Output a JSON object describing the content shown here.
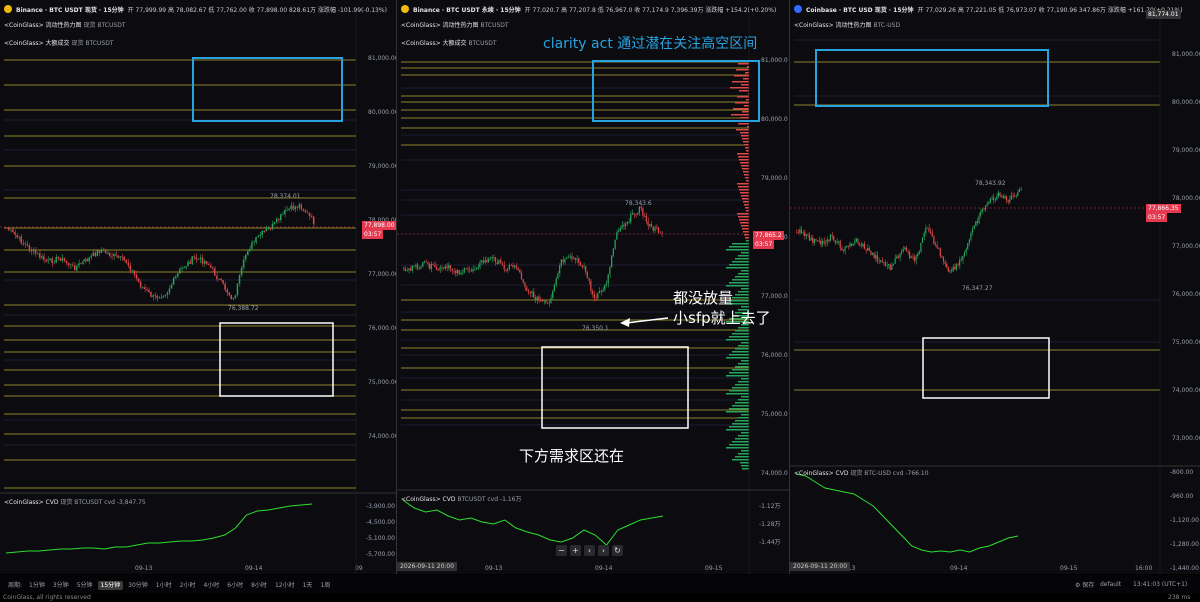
{
  "panel1": {
    "exchange_icon": "binance-icon",
    "title": "Binance · BTC USDT 现货 · 15分钟",
    "ohlc": "开 77,999.99  高 78,082.67  低 77,762.00  收 77,898.00  828.61万  涨跌幅 -101.99(-0.13%)",
    "heatmap_label": "<CoinGlass> 流动性热力图",
    "heatmap_sub": "现货 BTCUSDT",
    "bigtrade_label": "<CoinGlass> 大额成交",
    "bigtrade_sub": "现货 BTCUSDT",
    "cvd_label": "<CoinGlass> CVD",
    "cvd_sub": "现货 BTCUSDT  cvd -3,847.75",
    "high_label": "78,374.01",
    "low_label": "76,388.72",
    "price_axis": [
      "81,000.00",
      "80,000.00",
      "79,000.00",
      "78,000.00",
      "77,000.00",
      "76,000.00",
      "75,000.00",
      "74,000.00"
    ],
    "cvd_axis": [
      "-3,900.00",
      "-4,500.00",
      "-5,100.00",
      "-5,700.00"
    ],
    "price_tag": "77,898.00",
    "countdown": "03:57",
    "dates": [
      "09-13",
      "09-14",
      "09"
    ]
  },
  "panel2": {
    "exchange_icon": "binance-icon",
    "title": "Binance · BTC USDT 永续 · 15分钟",
    "ohlc": "开 77,020.7  高 77,207.8  低 76,967.0  收 77,174.9  7,396.39万  涨跌幅 +154.2(+0.20%)",
    "heatmap_label": "<CoinGlass> 流动性热力图",
    "heatmap_sub": "BTCUSDT",
    "bigtrade_label": "<CoinGlass> 大额成交",
    "bigtrade_sub": "BTCUSDT",
    "cvd_label": "<CoinGlass> CVD",
    "cvd_sub": "BTCUSDT  cvd -1.16万",
    "high_label": "78,343.6",
    "low_label": "76,350.1",
    "price_axis": [
      "81,000.0",
      "80,000.0",
      "79,000.0",
      "78,000.0",
      "77,000.0",
      "76,000.0",
      "75,000.0",
      "74,000.0"
    ],
    "cvd_axis": [
      "-1.12万",
      "-1.28万",
      "-1.44万"
    ],
    "price_tag": "77,865.2",
    "countdown": "03:57",
    "date_box": "2026-09-11 20:00",
    "dates": [
      "09-13",
      "09-14",
      "09-15"
    ]
  },
  "panel3": {
    "exchange_icon": "coinbase-icon",
    "title": "Coinbase · BTC USD 现货 · 15分钟",
    "ohlc": "开 77,029.26  高 77,221.05  低 76,973.07  收 77,190.96  347.86万  涨跌幅 +161.70(+0.21%)",
    "heatmap_label": "<CoinGlass> 流动性热力图",
    "heatmap_sub": "BTC-USD",
    "cvd_label": "<CoinGlass> CVD",
    "cvd_sub": "现货 BTC-USD  cvd -766.10",
    "high_label": "78,343.92",
    "low_label": "76,347.27",
    "price_axis": [
      "81,000.00",
      "80,000.00",
      "79,000.00",
      "78,000.00",
      "77,000.00",
      "76,000.00",
      "75,000.00",
      "74,000.00",
      "73,000.00"
    ],
    "cvd_axis": [
      "-800.00",
      "-960.00",
      "-1,120.00",
      "-1,280.00",
      "-1,440.00"
    ],
    "price_tag": "77,866.35",
    "countdown": "03:57",
    "top_tag": "81,774.01",
    "date_box": "2026-09-11 20:00",
    "dates": [
      "09-13",
      "09-14",
      "09-15",
      "16:00"
    ]
  },
  "annotations": {
    "top_note": "clarity act 通过潜在关注高空区间",
    "arrow_note_line1": "都没放量",
    "arrow_note_line2": "小sfp就上去了",
    "bottom_note": "下方需求区还在"
  },
  "footer": {
    "period_label": "周期:",
    "timeframes": [
      "1分钟",
      "3分钟",
      "5分钟",
      "15分钟",
      "30分钟",
      "1小时",
      "2小时",
      "4小时",
      "6小时",
      "8小时",
      "12小时",
      "1天",
      "1周"
    ],
    "active_timeframe": "15分钟",
    "save_label": "保存",
    "layout_label": "default",
    "clock": "13:41:03 (UTC+1)",
    "copyright": "CoinGlass, all rights reserved",
    "latency": "238 ms"
  },
  "colors": {
    "up": "#26a65b",
    "down": "#e04848",
    "liq_line": "#d8c93a",
    "cvd": "#2ee02e",
    "box_blue": "#29a3e0",
    "box_white": "#ffffff",
    "accent_red": "#e53950"
  }
}
